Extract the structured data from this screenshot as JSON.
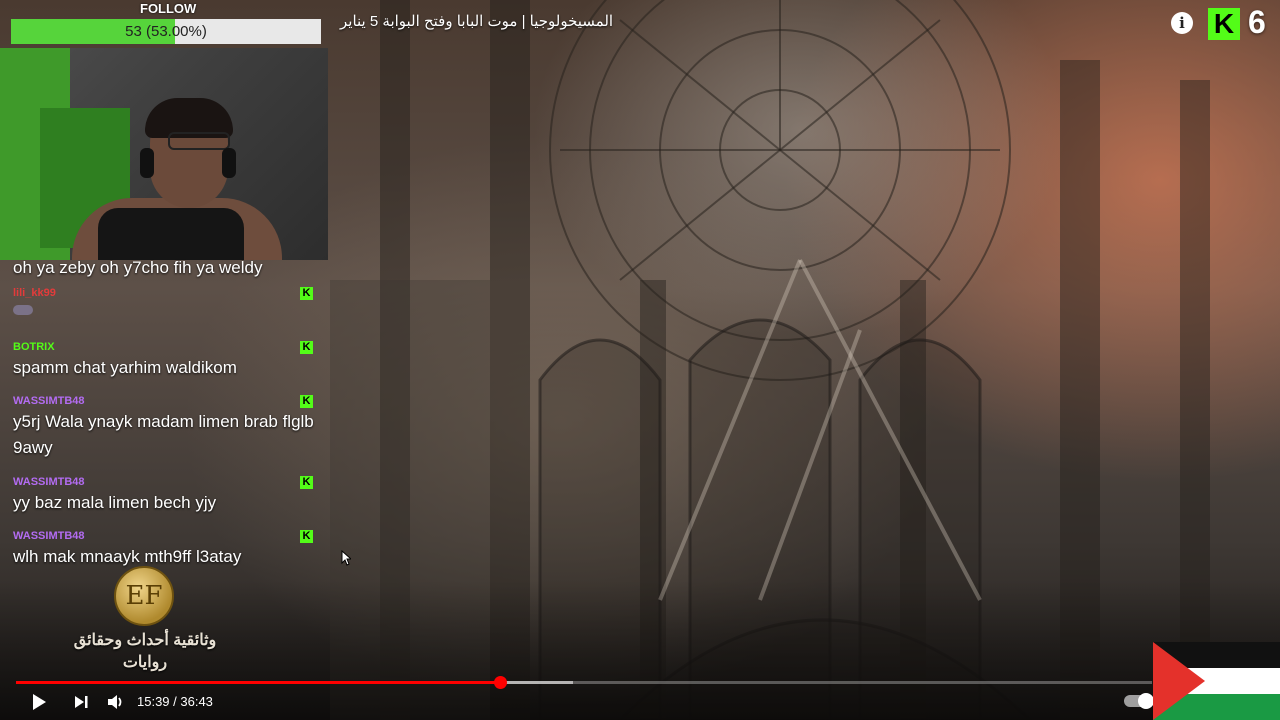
{
  "video": {
    "title": "المسيخولوجيا | موت البابا وفتح البوابة 5 يناير",
    "current_time": "15:39",
    "duration": "36:43",
    "time_display": "15:39 / 36:43",
    "progress_fraction": 0.4258,
    "buffered_fraction": 0.49
  },
  "header": {
    "info_icon": "info-icon",
    "kick_logo_letter": "K",
    "viewer_count": "6"
  },
  "follow_goal": {
    "label": "FOLLOW",
    "text": "53 (53.00%)",
    "fraction": 0.53,
    "fill_color": "#56d43b"
  },
  "chat": {
    "messages": [
      {
        "user": "",
        "text": "oh ya zeby oh y7cho fih ya weldy",
        "color": "#ffffff",
        "badge": false
      },
      {
        "user": "lili_kk99",
        "text": "",
        "color": "#e33b3b",
        "badge": true,
        "emote": true
      },
      {
        "user": "BOTRIX",
        "text": "spamm chat yarhim waldikom",
        "color": "#53fc18",
        "badge": true
      },
      {
        "user": "WASSIMTB48",
        "text": "y5rj Wala ynayk madam limen brab flglb 9awy",
        "color": "#b36cf2",
        "badge": true
      },
      {
        "user": "WASSIMTB48",
        "text": "yy baz mala limen bech yjy",
        "color": "#b36cf2",
        "badge": true
      },
      {
        "user": "WASSIMTB48",
        "text": "wlh mak mnaayk mth9ff l3atay",
        "color": "#b36cf2",
        "badge": true
      }
    ]
  },
  "watermark": {
    "logo_text": "EF",
    "line1": "وثائقية أحداث وحقائق",
    "line2": "روايات"
  },
  "controls": {
    "play_icon": "play-icon",
    "next_icon": "next-icon",
    "volume_icon": "volume-icon"
  },
  "colors": {
    "kick_green": "#53fc18",
    "progress_red": "#ff0000"
  }
}
